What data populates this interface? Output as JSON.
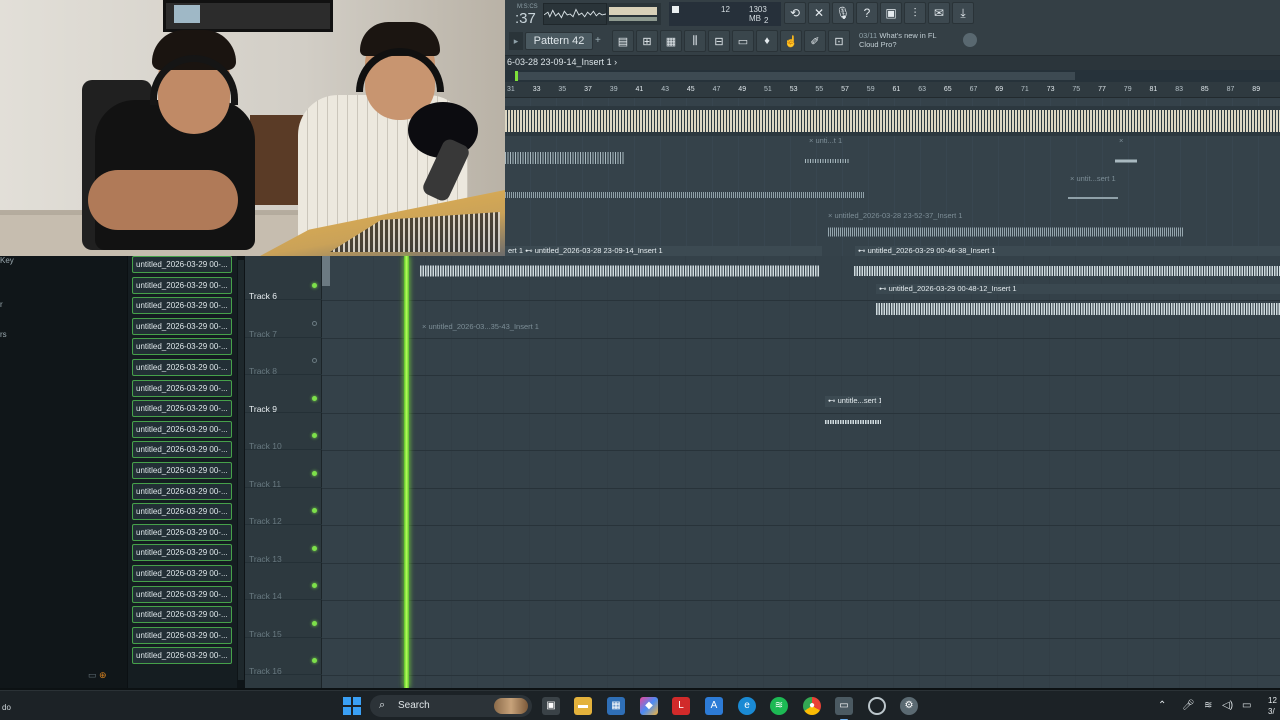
{
  "toolbar": {
    "time_small": "M:S:CS",
    "time_big": ":37",
    "cpu_value": "12",
    "ram_value": "1303 MB",
    "poly_value": "2",
    "pattern_label": "Pattern 42",
    "news_count": "03/11",
    "news_text_1": "What's new in FL",
    "news_text_2": "Cloud Pro?"
  },
  "playlist": {
    "title": "6-03-28 23-09-14_Insert 1",
    "title_arrow": "›",
    "ruler": [
      "31",
      "33",
      "35",
      "37",
      "39",
      "41",
      "43",
      "45",
      "47",
      "49",
      "51",
      "53",
      "55",
      "57",
      "59",
      "61",
      "63",
      "65",
      "67",
      "69",
      "71",
      "73",
      "75",
      "77",
      "79",
      "81",
      "83",
      "85",
      "87",
      "89"
    ],
    "clips": {
      "c1": "× unti...t 1",
      "c2": "× untit...sert 1",
      "c3": "× untitled_2026-03-28 23-52-37_Insert 1",
      "c4": "ert 1",
      "c5": "⊷ untitled_2026-03-28 23-09-14_Insert 1",
      "c6": "⊷ untitled_2026-03-29 00-46-38_Insert 1",
      "c7": "⊷ untitled_2026-03-29 00-48-12_Insert 1",
      "c8": "× untitled_2026-03...35-43_Insert 1",
      "c9": "⊷ untitle...sert 1"
    }
  },
  "left_panel": {
    "label_1": "Key",
    "label_2": "r",
    "label_3": "rs"
  },
  "browser": {
    "items": [
      "untitled_2026-03-29 00-...",
      "untitled_2026-03-29 00-...",
      "untitled_2026-03-29 00-...",
      "untitled_2026-03-29 00-...",
      "untitled_2026-03-29 00-...",
      "untitled_2026-03-29 00-...",
      "untitled_2026-03-29 00-...",
      "untitled_2026-03-29 00-...",
      "untitled_2026-03-29 00-...",
      "untitled_2026-03-29 00-...",
      "untitled_2026-03-29 00-...",
      "untitled_2026-03-29 00-...",
      "untitled_2026-03-29 00-...",
      "untitled_2026-03-29 00-...",
      "untitled_2026-03-29 00-...",
      "untitled_2026-03-29 00-...",
      "untitled_2026-03-29 00-...",
      "untitled_2026-03-29 00-...",
      "untitled_2026-03-29 00-...",
      "untitled_2026-03-29 00-..."
    ]
  },
  "tracks": [
    {
      "name": "Track 6",
      "active": true
    },
    {
      "name": "Track 7",
      "active": false
    },
    {
      "name": "Track 8",
      "active": false
    },
    {
      "name": "Track 9",
      "active": true
    },
    {
      "name": "Track 10",
      "active": true
    },
    {
      "name": "Track 11",
      "active": true
    },
    {
      "name": "Track 12",
      "active": true
    },
    {
      "name": "Track 13",
      "active": true
    },
    {
      "name": "Track 14",
      "active": true
    },
    {
      "name": "Track 15",
      "active": true
    },
    {
      "name": "Track 16",
      "active": true
    }
  ],
  "taskbar": {
    "left_text": "do",
    "search_label": "Search",
    "clock_1": "12",
    "clock_2": "3/"
  },
  "colors": {
    "playhead": "#7ee03a",
    "browser_border": "#46a14a",
    "windows_blue": "#3aa0f5"
  }
}
